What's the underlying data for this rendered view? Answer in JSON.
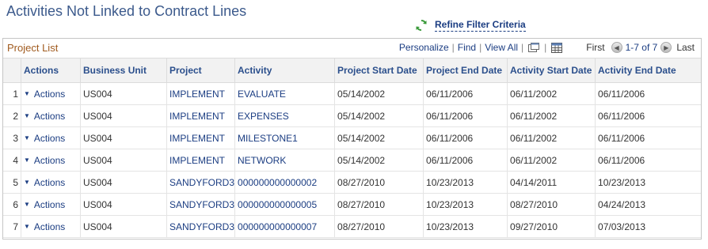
{
  "page": {
    "title": "Activities Not Linked to Contract Lines"
  },
  "refine": {
    "label": "Refine Filter Criteria"
  },
  "grid": {
    "label": "Project List",
    "nav": {
      "personalize": "Personalize",
      "find": "Find",
      "view_all": "View All",
      "first": "First",
      "range": "1-7 of 7",
      "last": "Last"
    },
    "columns": [
      "Actions",
      "Business Unit",
      "Project",
      "Activity",
      "Project Start Date",
      "Project End Date",
      "Activity Start Date",
      "Activity End Date"
    ],
    "rows": [
      {
        "num": "1",
        "action": "Actions",
        "bu": "US004",
        "project": "IMPLEMENT",
        "activity": "EVALUATE",
        "pstart": "05/14/2002",
        "pend": "06/11/2006",
        "astart": "06/11/2002",
        "aend": "06/11/2006"
      },
      {
        "num": "2",
        "action": "Actions",
        "bu": "US004",
        "project": "IMPLEMENT",
        "activity": "EXPENSES",
        "pstart": "05/14/2002",
        "pend": "06/11/2006",
        "astart": "06/11/2002",
        "aend": "06/11/2006"
      },
      {
        "num": "3",
        "action": "Actions",
        "bu": "US004",
        "project": "IMPLEMENT",
        "activity": "MILESTONE1",
        "pstart": "05/14/2002",
        "pend": "06/11/2006",
        "astart": "06/11/2002",
        "aend": "06/11/2006"
      },
      {
        "num": "4",
        "action": "Actions",
        "bu": "US004",
        "project": "IMPLEMENT",
        "activity": "NETWORK",
        "pstart": "05/14/2002",
        "pend": "06/11/2006",
        "astart": "06/11/2002",
        "aend": "06/11/2006"
      },
      {
        "num": "5",
        "action": "Actions",
        "bu": "US004",
        "project": "SANDYFORD3",
        "activity": "000000000000002",
        "pstart": "08/27/2010",
        "pend": "10/23/2013",
        "astart": "04/14/2011",
        "aend": "10/23/2013"
      },
      {
        "num": "6",
        "action": "Actions",
        "bu": "US004",
        "project": "SANDYFORD3",
        "activity": "000000000000005",
        "pstart": "08/27/2010",
        "pend": "10/23/2013",
        "astart": "08/27/2010",
        "aend": "04/24/2013"
      },
      {
        "num": "7",
        "action": "Actions",
        "bu": "US004",
        "project": "SANDYFORD3",
        "activity": "000000000000007",
        "pstart": "08/27/2010",
        "pend": "10/23/2013",
        "astart": "09/27/2010",
        "aend": "07/03/2013"
      }
    ]
  },
  "icons": {
    "refresh": "refresh-icon",
    "zoom": "zoom-window-icon",
    "download": "download-grid-icon",
    "first": "previous-arrow-icon",
    "last": "next-arrow-icon",
    "caret": "caret-down-icon"
  },
  "colors": {
    "title": "#3c5a8c",
    "link": "#1b3d82",
    "grid_label": "#a05a1e",
    "header_bg": "#f2f2f2"
  }
}
